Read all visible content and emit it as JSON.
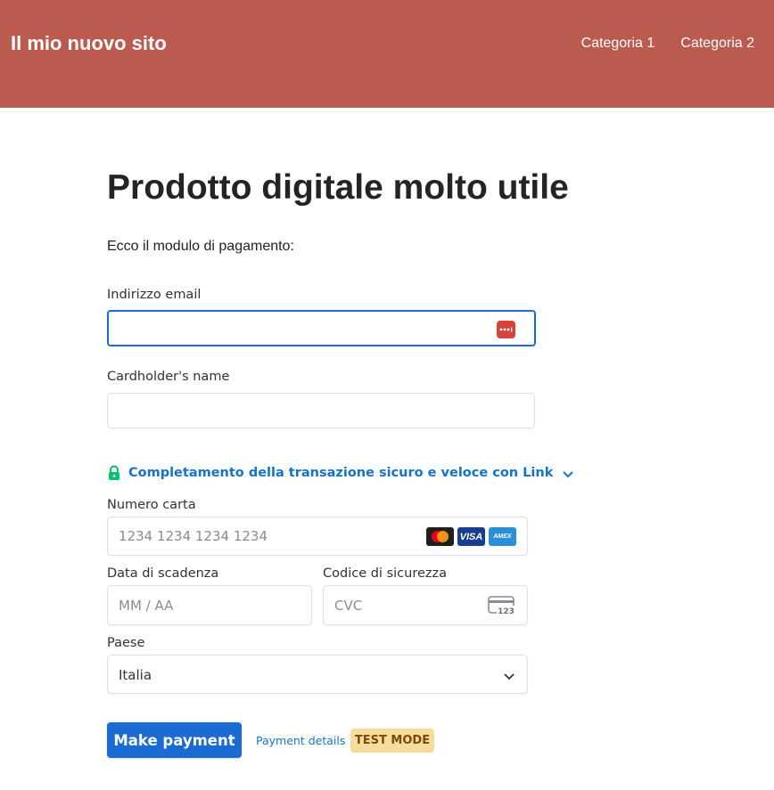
{
  "header": {
    "site_title": "Il mio nuovo sito",
    "nav": [
      {
        "label": "Categoria 1"
      },
      {
        "label": "Categoria 2"
      }
    ],
    "bg_color": "#bb5a4f"
  },
  "main": {
    "title": "Prodotto digitale molto utile",
    "intro": "Ecco il modulo di pagamento:"
  },
  "form": {
    "email": {
      "label": "Indirizzo email",
      "value": "",
      "placeholder": "",
      "icon": "password-manager-icon"
    },
    "cardholder": {
      "label": "Cardholder's name",
      "value": "",
      "placeholder": ""
    },
    "link": {
      "text": "Completamento della transazione sicuro e veloce con Link",
      "icon": "lock-icon"
    },
    "card_number": {
      "label": "Numero carta",
      "placeholder": "1234 1234 1234 1234",
      "brands": [
        "mastercard",
        "VISA",
        "AMEX"
      ]
    },
    "expiry": {
      "label": "Data di scadenza",
      "placeholder": "MM / AA"
    },
    "cvc": {
      "label": "Codice di sicurezza",
      "placeholder": "CVC",
      "icon_text": "123"
    },
    "country": {
      "label": "Paese",
      "value": "Italia"
    },
    "submit_label": "Make payment",
    "details_link": "Payment details",
    "test_badge": "TEST MODE"
  },
  "colors": {
    "accent": "#1a6bd4",
    "link": "#1573c9",
    "badge_bg": "#f7dc9b"
  }
}
